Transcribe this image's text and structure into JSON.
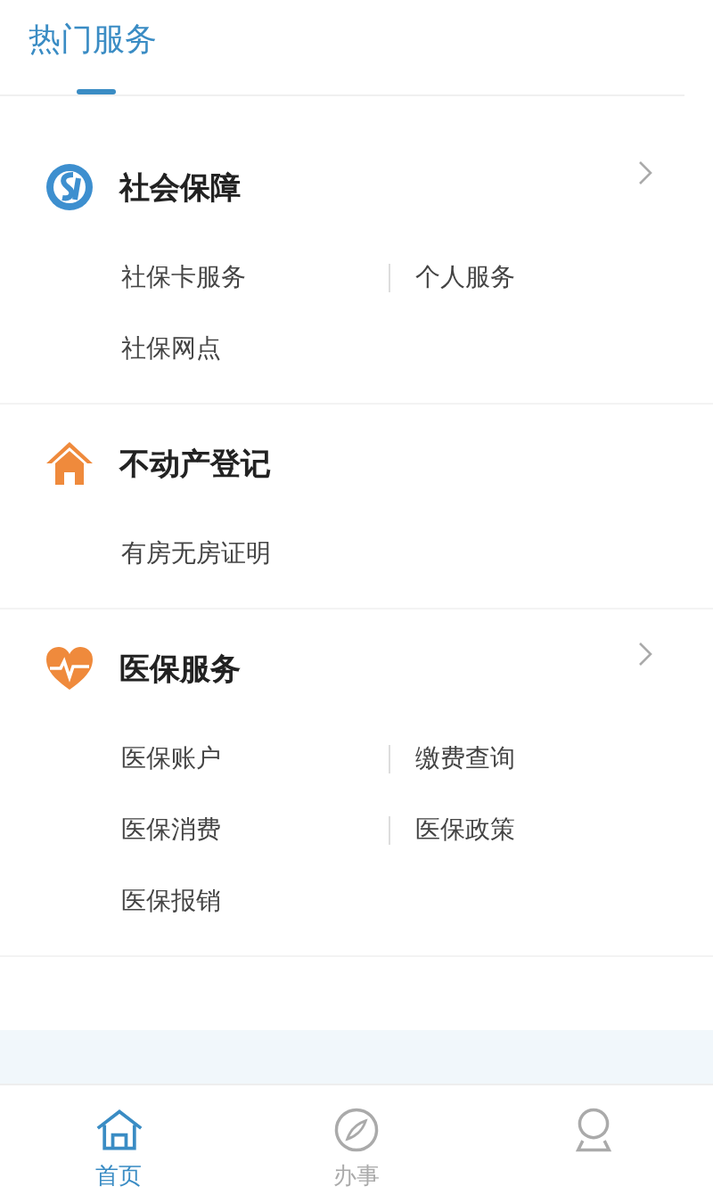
{
  "header": {
    "title": "热门服务"
  },
  "sections": [
    {
      "title": "社会保障",
      "kind": "si",
      "chevron": true,
      "items": [
        "社保卡服务",
        "个人服务",
        "社保网点"
      ]
    },
    {
      "title": "不动产登记",
      "kind": "house",
      "chevron": false,
      "items": [
        "有房无房证明"
      ]
    },
    {
      "title": "医保服务",
      "kind": "heart",
      "chevron": true,
      "items": [
        "医保账户",
        "缴费查询",
        "医保消费",
        "医保政策",
        "医保报销"
      ]
    }
  ],
  "tabs": [
    {
      "label": "首页",
      "kind": "home",
      "selected": true
    },
    {
      "label": "办事",
      "kind": "compass",
      "selected": false
    },
    {
      "kind": "person",
      "selected": false
    }
  ]
}
